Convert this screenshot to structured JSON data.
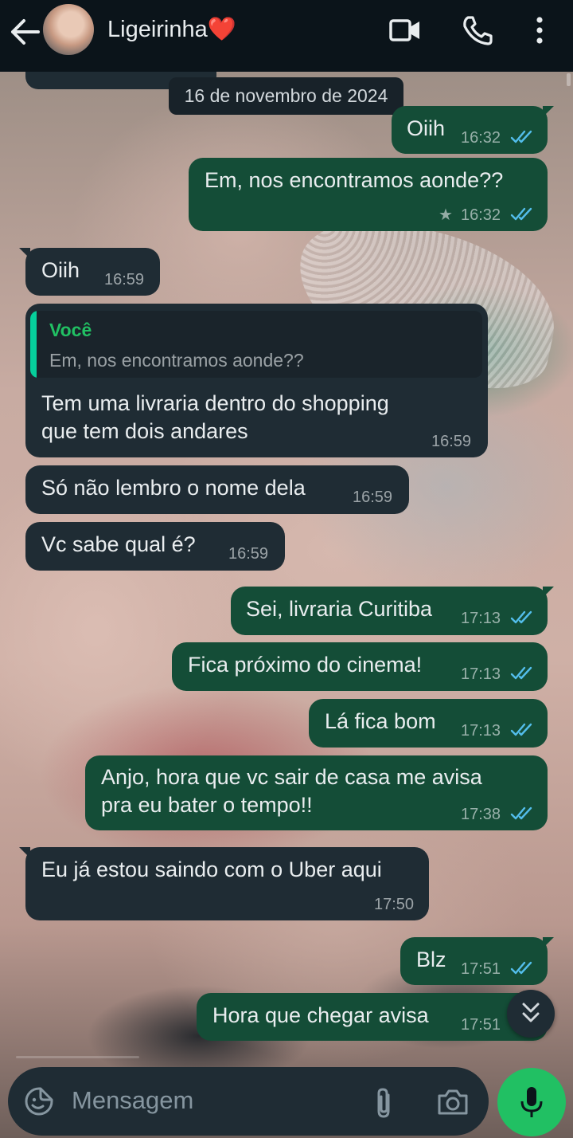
{
  "header": {
    "contact_name": "Ligeirinha",
    "contact_emoji": "❤️"
  },
  "date_chip": "16 de novembro de 2024",
  "messages": [
    {
      "dir": "out",
      "text": "Oiih",
      "time": "16:32",
      "read": true
    },
    {
      "dir": "out",
      "text": "Em, nos encontramos aonde??",
      "time": "16:32",
      "read": true,
      "starred": true
    },
    {
      "dir": "in",
      "text": "Oiih",
      "time": "16:59"
    },
    {
      "dir": "in",
      "quote_author": "Você",
      "quote_text": "Em, nos encontramos aonde??",
      "lines": [
        "Tem uma livraria dentro do shopping",
        "que tem dois andares"
      ],
      "time": "16:59"
    },
    {
      "dir": "in",
      "text": "Só não lembro o nome dela",
      "time": "16:59"
    },
    {
      "dir": "in",
      "text": "Vc sabe qual é?",
      "time": "16:59"
    },
    {
      "dir": "out",
      "text": "Sei, livraria Curitiba",
      "time": "17:13",
      "read": true
    },
    {
      "dir": "out",
      "text": "Fica próximo do cinema!",
      "time": "17:13",
      "read": true
    },
    {
      "dir": "out",
      "text": "Lá fica bom",
      "time": "17:13",
      "read": true
    },
    {
      "dir": "out",
      "lines": [
        "Anjo, hora que vc sair de casa me avisa",
        "pra eu bater o tempo!!"
      ],
      "time": "17:38",
      "read": true
    },
    {
      "dir": "in",
      "text": "Eu já estou saindo com o Uber aqui",
      "time": "17:50"
    },
    {
      "dir": "out",
      "text": "Blz",
      "time": "17:51",
      "read": true
    },
    {
      "dir": "out",
      "text": "Hora que chegar avisa",
      "time": "17:51",
      "read": true
    }
  ],
  "composer": {
    "placeholder": "Mensagem"
  },
  "colors": {
    "outgoing_bubble": "#144d37",
    "incoming_bubble": "#1f2c34",
    "read_ticks": "#53bdeb",
    "mic_button": "#21c063"
  }
}
